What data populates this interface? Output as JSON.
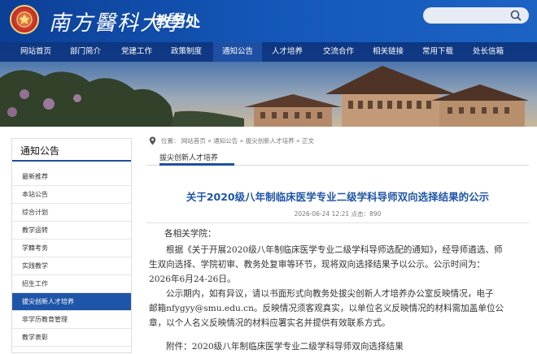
{
  "header": {
    "school_name": "南方醫科大學",
    "office_name": "教务处",
    "search_placeholder": ""
  },
  "nav": {
    "items": [
      "网站首页",
      "部门简介",
      "党建工作",
      "政策制度",
      "通知公告",
      "人才培养",
      "交流合作",
      "相关链接",
      "常用下载",
      "处长信箱"
    ]
  },
  "sidebar": {
    "title": "通知公告",
    "items": [
      "最新推荐",
      "本站公告",
      "综合计划",
      "教学运转",
      "学籍考务",
      "实践教学",
      "招生工作",
      "拔尖创新人才培养",
      "非学历教育管理",
      "教学表彰"
    ],
    "active_index": 7
  },
  "breadcrumb": {
    "prefix": "位置：",
    "items": [
      "网站首页",
      "通知公告",
      "拔尖创新人才培养",
      "正文"
    ],
    "separator": "»"
  },
  "section_tab": "拔尖创新人才培养",
  "article": {
    "title": "关于2020级八年制临床医学专业二级学科导师双向选择结果的公示",
    "meta": "2026-06-24 12:21 点击：890",
    "greeting": "各相关学院：",
    "para1_lines": [
      "根据《关于开展2020级八年制临床医学专业二级学科导师选配的通知》，经导师遴选、师",
      "生双向选择、学院初审、教务处复审等环节，现将双向选择结果予以公示。公示时间为：",
      "2026年6月24-26日。"
    ],
    "para2_lines": [
      "公示期内，如有异议，请以书面形式向教务处拔尖创新人才培养办公室反映情况，电子",
      "邮箱nfygyy@smu.edu.cn。反映情况须客观真实，以单位名义反映情况的材料需加盖单位公",
      "章，以个人名义反映情况的材料应署实名并提供有效联系方式。"
    ],
    "attachment": "附件：2020级八年制临床医学专业二级学科导师双向选择结果"
  },
  "colors": {
    "brand_blue": "#1457b8",
    "nav_blue": "#0c3480",
    "title_blue": "#1f55a8",
    "active_side": "#1f55a8"
  }
}
